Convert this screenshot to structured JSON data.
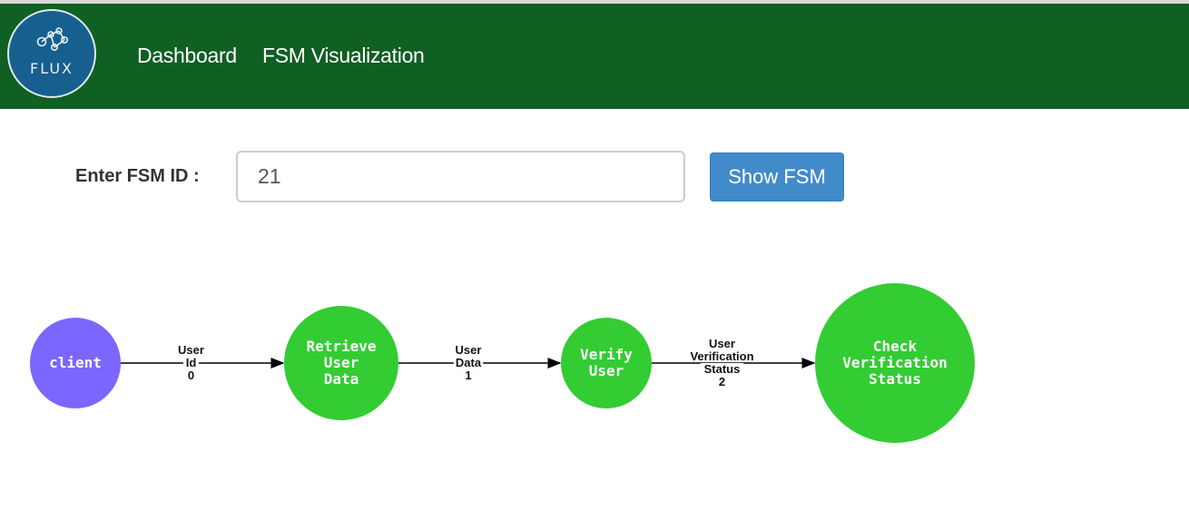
{
  "header": {
    "logo_text": "FLUX",
    "nav": [
      {
        "label": "Dashboard"
      },
      {
        "label": "FSM Visualization"
      }
    ]
  },
  "form": {
    "label": "Enter FSM ID :",
    "input_value": "21",
    "button_label": "Show FSM"
  },
  "fsm": {
    "colors": {
      "client_node": "#7b66ff",
      "state_node": "#33cc33",
      "edge": "#000000"
    },
    "nodes": [
      {
        "id": "client",
        "lines": [
          "client"
        ],
        "kind": "client"
      },
      {
        "id": "retrieve-user-data",
        "lines": [
          "Retrieve",
          "User",
          "Data"
        ],
        "kind": "state"
      },
      {
        "id": "verify-user",
        "lines": [
          "Verify",
          "User"
        ],
        "kind": "state"
      },
      {
        "id": "check-verification-status",
        "lines": [
          "Check",
          "Verification",
          "Status"
        ],
        "kind": "state"
      }
    ],
    "edges": [
      {
        "from": "client",
        "to": "retrieve-user-data",
        "lines": [
          "User",
          "Id",
          "0"
        ]
      },
      {
        "from": "retrieve-user-data",
        "to": "verify-user",
        "lines": [
          "User",
          "Data",
          "1"
        ]
      },
      {
        "from": "verify-user",
        "to": "check-verification-status",
        "lines": [
          "User",
          "Verification",
          "Status",
          "2"
        ]
      }
    ]
  }
}
